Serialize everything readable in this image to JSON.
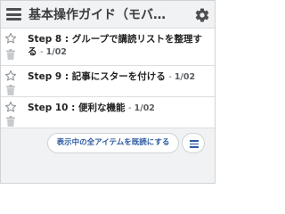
{
  "header": {
    "title": "基本操作ガイド（モバ…",
    "menu_icon": "hamburger-menu-icon",
    "settings_icon": "gear-icon"
  },
  "items": [
    {
      "title": "Step 8 : グループで講読リストを整理する",
      "date": "1/02"
    },
    {
      "title": "Step 9 : 記事にスターを付ける",
      "date": "1/02"
    },
    {
      "title": "Step 10 : 便利な機能",
      "date": "1/02"
    }
  ],
  "footer": {
    "mark_all_read_label": "表示中の全アイテムを既読にする",
    "list_menu_icon": "list-menu-icon"
  },
  "colors": {
    "accent": "#2c5aa0",
    "header_bg": "#f1f2f3",
    "icon": "#4d4f51"
  }
}
